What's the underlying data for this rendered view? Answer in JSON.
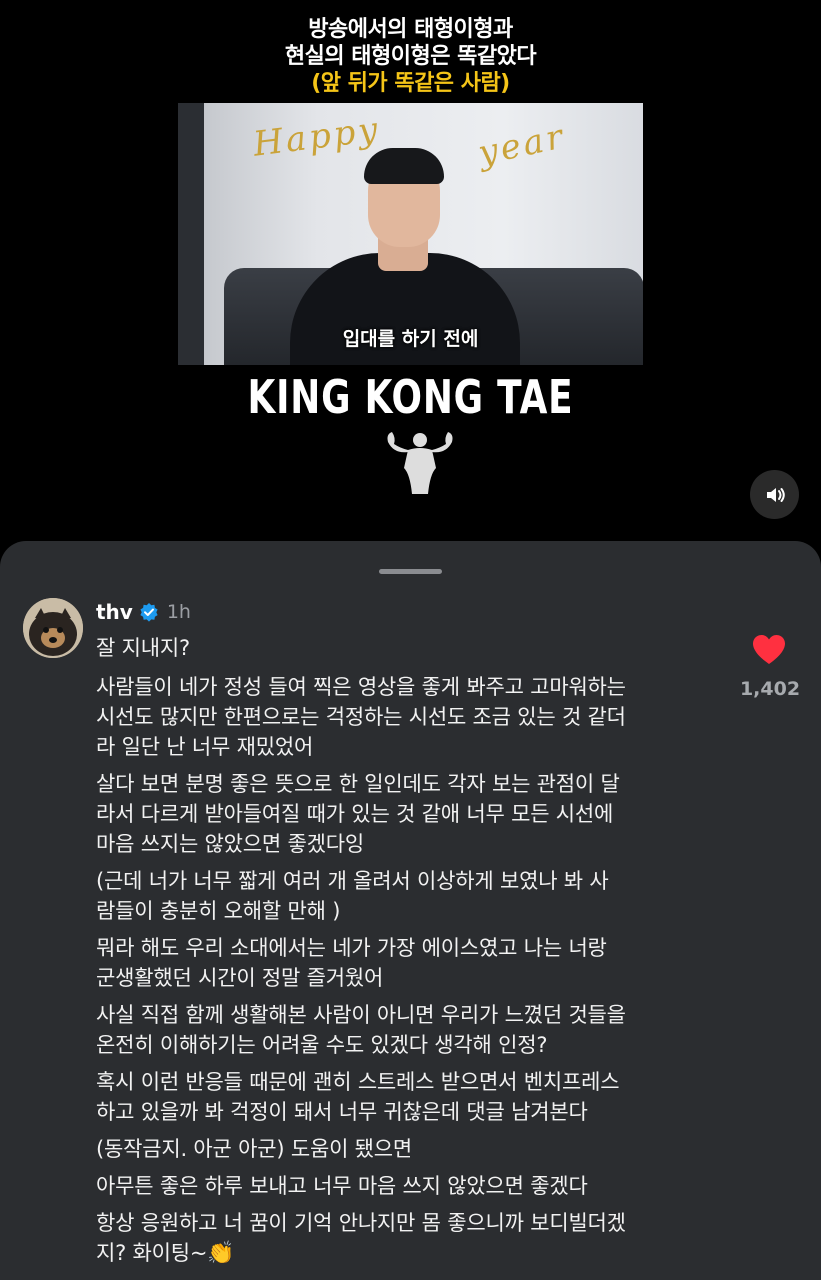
{
  "video": {
    "headline_line1": "방송에서의 태형이형과",
    "headline_line2": "현실의 태형이형은 똑같았다",
    "headline_line3": "(앞 뒤가 똑같은 사람)",
    "banner_text_left": "Happy",
    "banner_text_right": "year",
    "subtitle": "입대를 하기 전에",
    "logo": "KING KONG TAE",
    "mute_icon": "speaker-icon",
    "colors": {
      "headline_accent": "#f5c518"
    }
  },
  "comment": {
    "username": "thv",
    "verified_icon": "verified-badge-icon",
    "time": "1h",
    "like_count": "1,402",
    "like_icon": "heart-icon",
    "like_color": "#ff3040",
    "lines": [
      "잘 지내지?",
      "사람들이 네가 정성 들여 찍은 영상을 좋게 봐주고 고마워하는",
      "시선도 많지만 한편으로는 걱정하는 시선도 조금 있는 것 같더",
      "라 일단 난 너무 재밌었어",
      "살다 보면 분명 좋은 뜻으로 한 일인데도 각자 보는 관점이 달",
      "라서 다르게 받아들여질 때가 있는 것 같애 너무 모든 시선에",
      "마음 쓰지는 않았으면 좋겠다잉",
      "(근데 너가 너무 짧게 여러 개 올려서 이상하게 보였나 봐 사",
      "람들이 충분히 오해할 만해 )",
      "뭐라 해도 우리 소대에서는 네가 가장 에이스였고 나는 너랑",
      "군생활했던 시간이 정말 즐거웠어",
      "사실 직접 함께 생활해본 사람이 아니면 우리가 느꼈던 것들을",
      "온전히 이해하기는 어려울 수도 있겠다 생각해 인정?",
      "혹시 이런 반응들 때문에 괜히 스트레스 받으면서 벤치프레스",
      "하고 있을까 봐 걱정이 돼서 너무 귀찮은데 댓글 남겨본다",
      "(동작금지. 아군 아군) 도움이 됐으면",
      "아무튼 좋은 하루 보내고 너무 마음 쓰지 않았으면 좋겠다",
      "항상 응원하고 너 꿈이 기억 안나지만 몸 좋으니까 보디빌더겠",
      "지? 화이팅~"
    ],
    "clap_emoji": "👏"
  }
}
